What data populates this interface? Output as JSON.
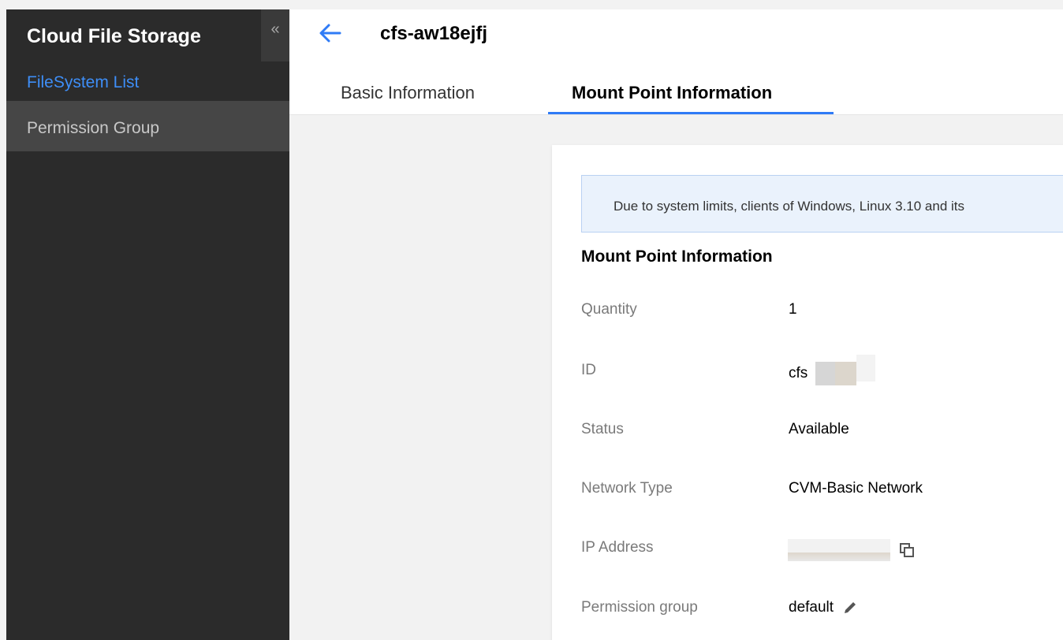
{
  "sidebar": {
    "title": "Cloud File Storage",
    "collapse_glyph": "«",
    "items": [
      {
        "label": "FileSystem List",
        "state": "active"
      },
      {
        "label": "Permission Group",
        "state": "hover"
      }
    ]
  },
  "header": {
    "title": "cfs-aw18ejfj",
    "back_icon": "arrow-left-icon",
    "tabs": [
      {
        "label": "Basic Information",
        "active": false
      },
      {
        "label": "Mount Point Information",
        "active": true
      }
    ]
  },
  "notice": {
    "text": "Due to system limits, clients of Windows, Linux 3.10 and its"
  },
  "mount_info": {
    "section_title": "Mount Point Information",
    "rows": [
      {
        "label": "Quantity",
        "value": "1"
      },
      {
        "label": "ID",
        "value": "cfs"
      },
      {
        "label": "Status",
        "value": "Available"
      },
      {
        "label": "Network Type",
        "value": "CVM-Basic Network"
      },
      {
        "label": "IP Address",
        "value": ""
      },
      {
        "label": "Permission group",
        "value": "default"
      }
    ]
  },
  "colors": {
    "accent": "#2f7bf6",
    "sidebar_bg": "#2b2b2b",
    "sidebar_active": "#3e8ef7",
    "notice_bg": "#eaf2fc"
  }
}
